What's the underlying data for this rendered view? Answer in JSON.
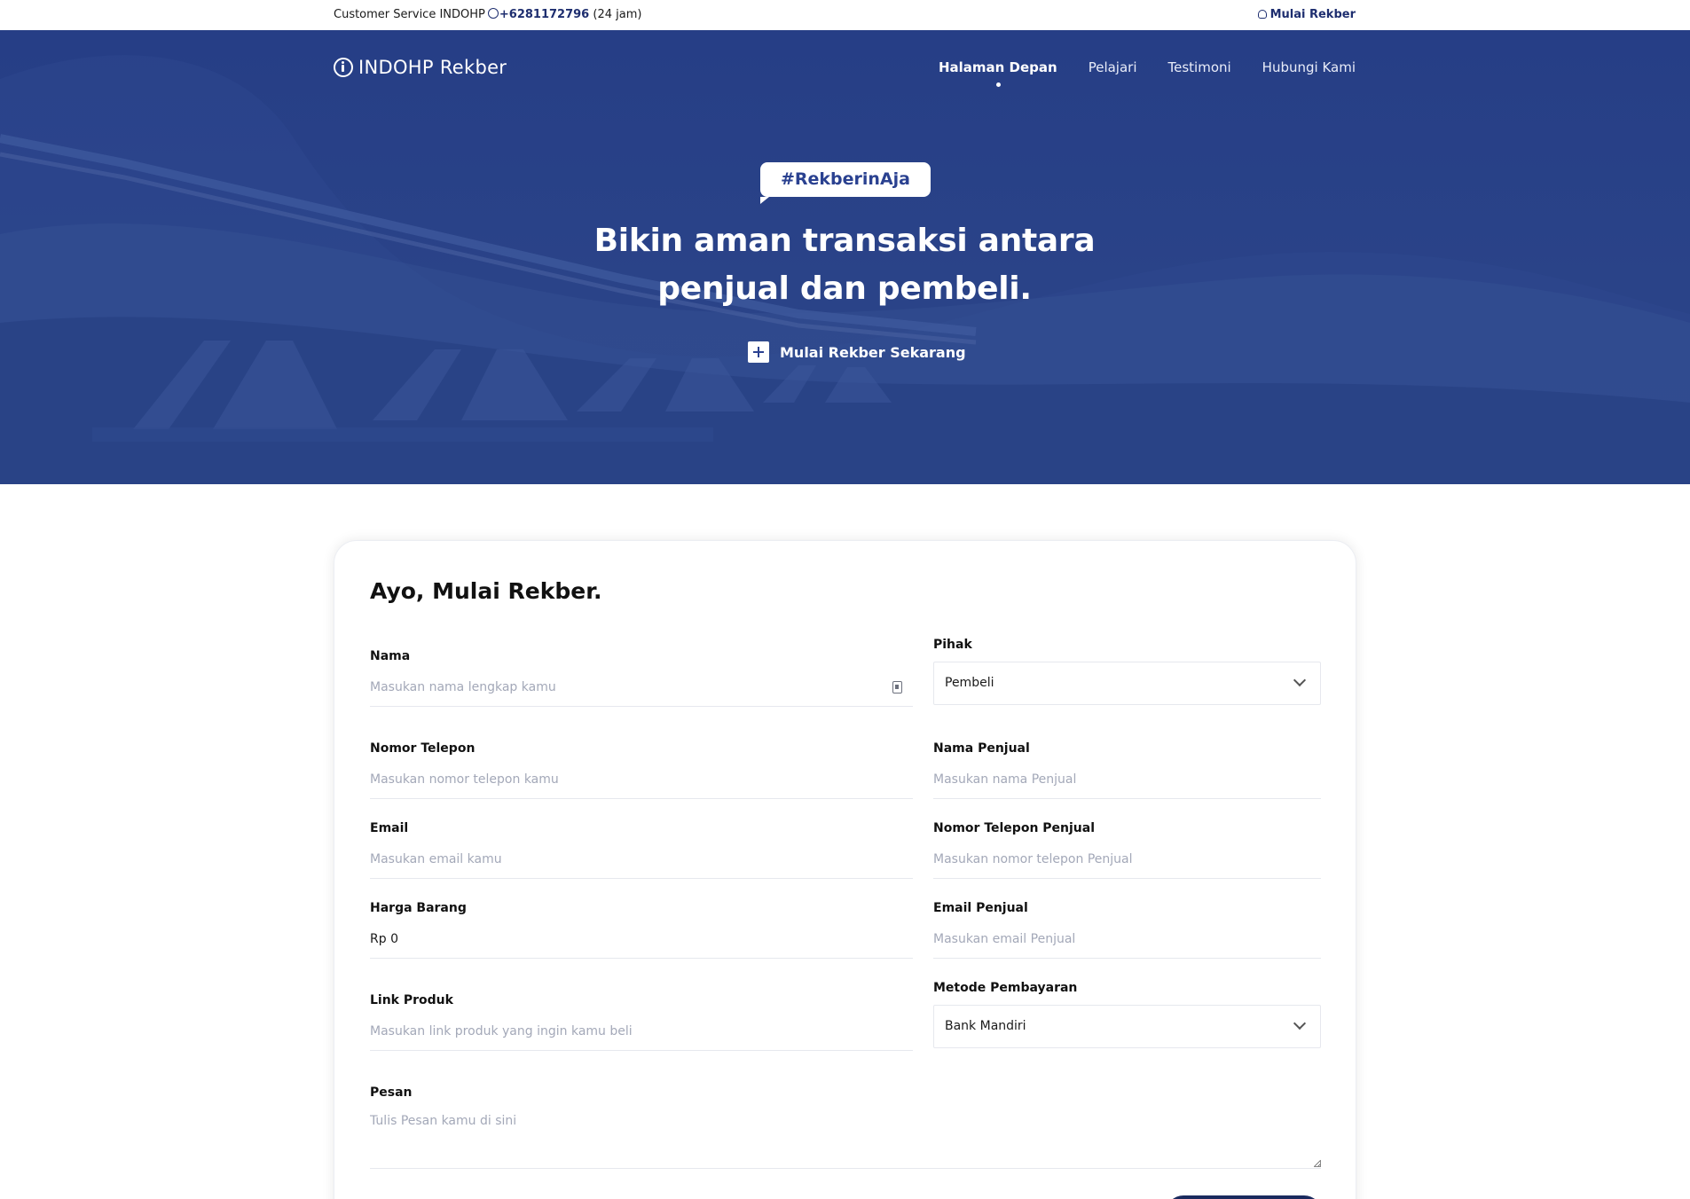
{
  "topbar": {
    "cs_label": "Customer Service INDOHP",
    "phone": "+6281172796",
    "hours": "(24 jam)",
    "login_label": "Mulai Rekber"
  },
  "brand": {
    "name": "INDOHP Rekber"
  },
  "nav": {
    "items": [
      {
        "label": "Halaman Depan",
        "active": true
      },
      {
        "label": "Pelajari",
        "active": false
      },
      {
        "label": "Testimoni",
        "active": false
      },
      {
        "label": "Hubungi Kami",
        "active": false
      }
    ]
  },
  "hero": {
    "tag": "#RekberinAja",
    "headline_line1": "Bikin aman transaksi antara",
    "headline_line2": "penjual dan pembeli.",
    "cta_label": "Mulai Rekber Sekarang"
  },
  "form": {
    "title": "Ayo, Mulai Rekber.",
    "nama": {
      "label": "Nama",
      "placeholder": "Masukan nama lengkap kamu",
      "value": ""
    },
    "pihak": {
      "label": "Pihak",
      "selected": "Pembeli"
    },
    "telepon": {
      "label": "Nomor Telepon",
      "placeholder": "Masukan nomor telepon kamu",
      "value": ""
    },
    "nama_penjual": {
      "label": "Nama Penjual",
      "placeholder": "Masukan nama Penjual",
      "value": ""
    },
    "email": {
      "label": "Email",
      "placeholder": "Masukan email kamu",
      "value": ""
    },
    "telepon_penjual": {
      "label": "Nomor Telepon Penjual",
      "placeholder": "Masukan nomor telepon Penjual",
      "value": ""
    },
    "harga": {
      "label": "Harga Barang",
      "value": "Rp 0"
    },
    "email_penjual": {
      "label": "Email Penjual",
      "placeholder": "Masukan email Penjual",
      "value": ""
    },
    "link": {
      "label": "Link Produk",
      "placeholder": "Masukan link produk yang ingin kamu beli",
      "value": ""
    },
    "metode": {
      "label": "Metode Pembayaran",
      "selected": "Bank Mandiri"
    },
    "pesan": {
      "label": "Pesan",
      "placeholder": "Tulis Pesan kamu di sini",
      "value": ""
    }
  },
  "colors": {
    "brand_navy": "#2a4190",
    "hero_bg": "#263e86",
    "submit_bg": "#1a2a5e"
  },
  "icons": {
    "whatsapp": "whatsapp-icon",
    "user": "user-icon",
    "logo": "logo-icon",
    "plus": "plus-icon",
    "contact_card": "contact-card-icon",
    "chevron": "chevron-down-icon"
  }
}
